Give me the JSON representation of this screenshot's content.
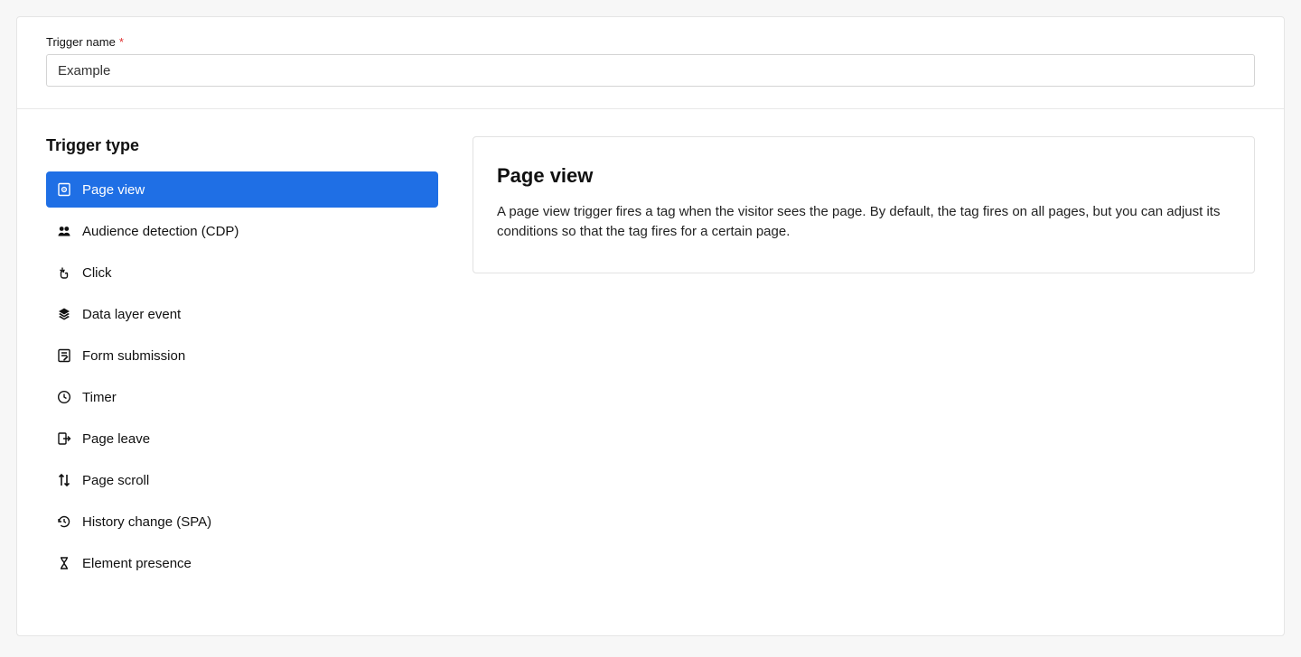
{
  "form": {
    "trigger_name_label": "Trigger name",
    "required_mark": "*",
    "trigger_name_value": "Example"
  },
  "trigger_type": {
    "heading": "Trigger type",
    "items": [
      {
        "label": "Page view",
        "selected": true,
        "icon": "page-view-icon"
      },
      {
        "label": "Audience detection (CDP)",
        "selected": false,
        "icon": "audience-icon"
      },
      {
        "label": "Click",
        "selected": false,
        "icon": "click-icon"
      },
      {
        "label": "Data layer event",
        "selected": false,
        "icon": "layers-icon"
      },
      {
        "label": "Form submission",
        "selected": false,
        "icon": "form-submit-icon"
      },
      {
        "label": "Timer",
        "selected": false,
        "icon": "clock-icon"
      },
      {
        "label": "Page leave",
        "selected": false,
        "icon": "page-leave-icon"
      },
      {
        "label": "Page scroll",
        "selected": false,
        "icon": "page-scroll-icon"
      },
      {
        "label": "History change (SPA)",
        "selected": false,
        "icon": "history-icon"
      },
      {
        "label": "Element presence",
        "selected": false,
        "icon": "hourglass-icon"
      }
    ]
  },
  "info": {
    "title": "Page view",
    "description": "A page view trigger fires a tag when the visitor sees the page. By default, the tag fires on all pages, but you can adjust its conditions so that the tag fires for a certain page."
  }
}
